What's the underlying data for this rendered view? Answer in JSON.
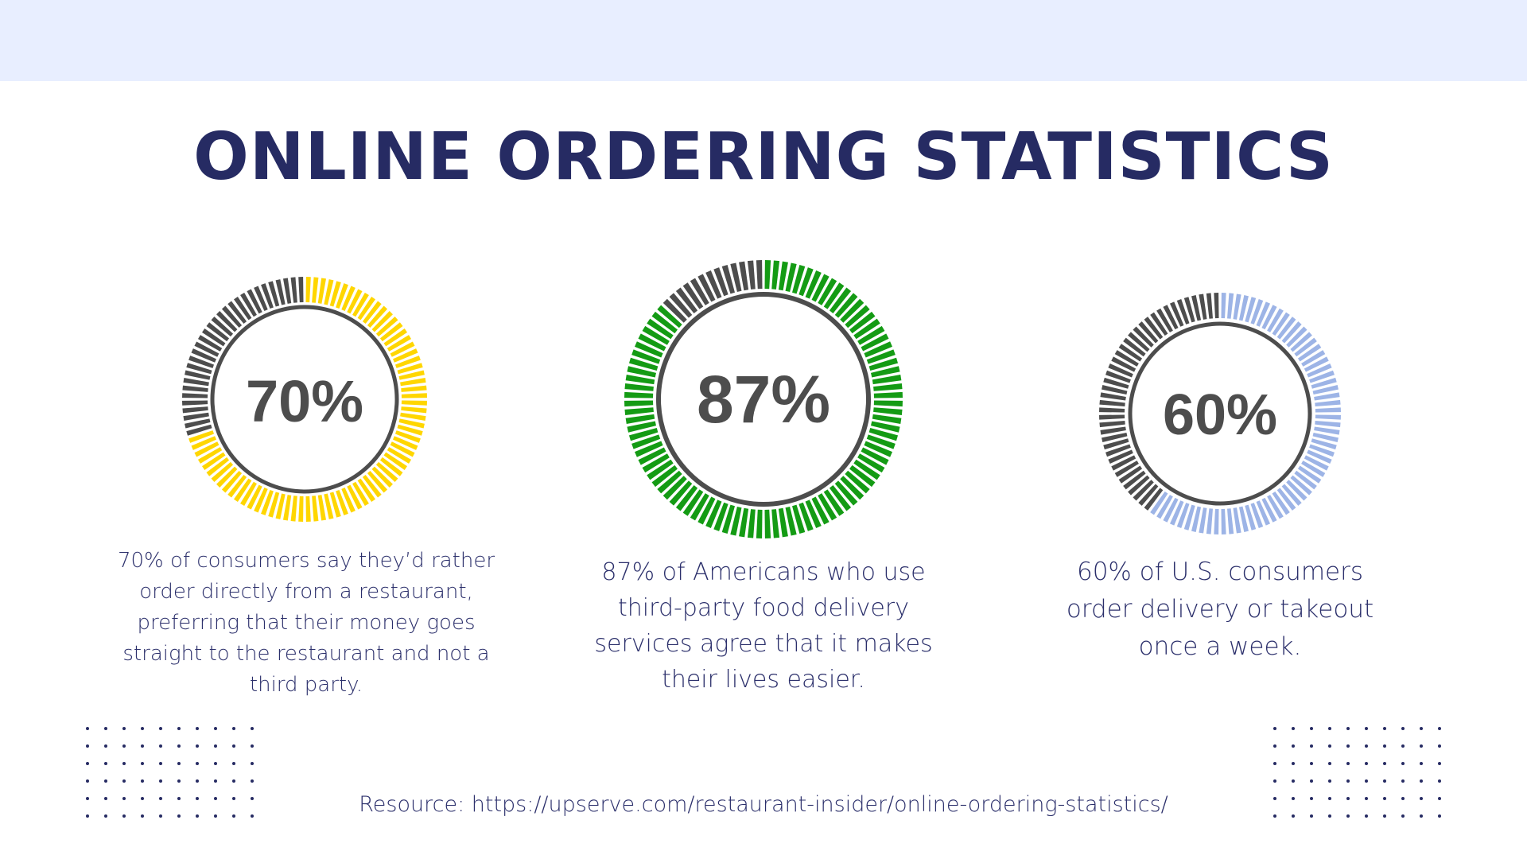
{
  "title": "ONLINE ORDERING STATISTICS",
  "colors": {
    "remainder": "#4d4d4d",
    "title": "#262b63"
  },
  "chart_data": {
    "type": "pie",
    "title": "ONLINE ORDERING STATISTICS",
    "items": [
      {
        "value": 70,
        "label": "70%",
        "color": "#ffd600",
        "description": "70% of consumers say they’d rather order directly from a restaurant, preferring that their money goes straight to the restaurant and not a third party."
      },
      {
        "value": 87,
        "label": "87%",
        "color": "#149b14",
        "description": "87% of Americans who use third-party food delivery services agree that it makes their lives easier."
      },
      {
        "value": 60,
        "label": "60%",
        "color": "#9db4e6",
        "description": "60% of U.S. consumers order delivery or takeout once a week."
      }
    ]
  },
  "resource": "Resource: https://upserve.com/restaurant-insider/online-ordering-statistics/"
}
